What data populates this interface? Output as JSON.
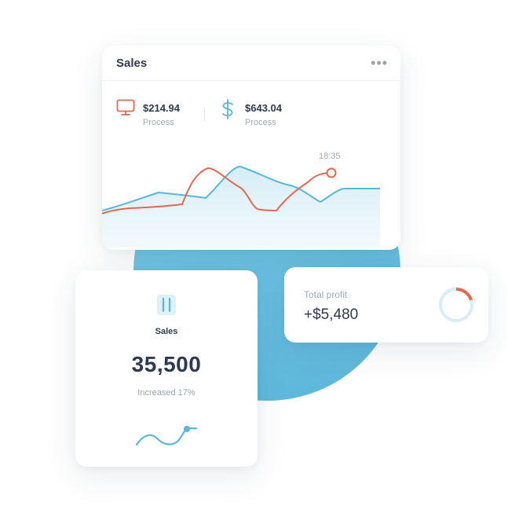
{
  "sales_card": {
    "title": "Sales",
    "more_icon": "more-horizontal-icon",
    "metrics": [
      {
        "icon": "monitor-icon",
        "value": "$214.94",
        "label": "Process",
        "color": "#e06a53"
      },
      {
        "icon": "dollar-icon",
        "value": "$643.04",
        "label": "Process",
        "color": "#5ab6da"
      }
    ],
    "chart_time": "18:35"
  },
  "small_card": {
    "icon": "pause-icon",
    "label": "Sales",
    "value": "35,500",
    "subtext": "Increased 17%"
  },
  "profit_card": {
    "label": "Total profit",
    "value": "+$5,480",
    "progress_fraction": 0.2
  },
  "colors": {
    "blue": "#5ab6da",
    "orange": "#e06a53",
    "text_dark": "#2f3a52",
    "text_muted": "#a3aab6"
  }
}
